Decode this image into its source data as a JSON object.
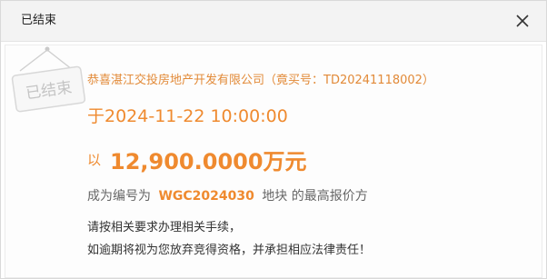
{
  "dialog": {
    "title": "已结束",
    "close_icon": "close-icon"
  },
  "stamp": {
    "text": "已结束",
    "icon": "hanging-sign-icon"
  },
  "result": {
    "company_line": "恭喜湛江交投房地产开发有限公司（竟买号：TD20241118002）",
    "date_line": "于2024-11-22 10:00:00",
    "price_prefix": "以",
    "price_value": "12,900.0000万元",
    "winner_prefix": "成为编号为",
    "winner_code": "WGC2024030",
    "winner_suffix": "地块 的最高报价方",
    "notice_line1": "请按相关要求办理相关手续，",
    "notice_line2": "如逾期将视为您放弃竞得资格，并承担相应法律责任！"
  },
  "colors": {
    "accent": "#ef8a2f",
    "company_text": "#e28a38",
    "title_bar": "#f3f3f3",
    "body_text": "#333333",
    "muted_text": "#666666"
  }
}
